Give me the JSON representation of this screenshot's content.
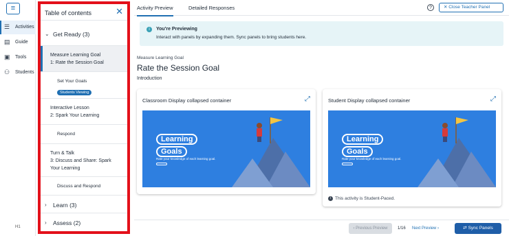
{
  "rail": {
    "menu_icon": "hamburger-icon",
    "items": [
      {
        "label": "Activities",
        "icon": "list-icon"
      },
      {
        "label": "Guide",
        "icon": "book-icon"
      },
      {
        "label": "Tools",
        "icon": "toolbox-icon"
      },
      {
        "label": "Students",
        "icon": "people-icon"
      }
    ],
    "footer_alt": "H1"
  },
  "toc": {
    "title": "Table of contents",
    "sections": [
      {
        "label": "Get Ready (3)",
        "expanded": true
      },
      {
        "label": "Learn (3)",
        "expanded": false
      },
      {
        "label": "Assess (2)",
        "expanded": false
      }
    ],
    "lessons": [
      {
        "line1": "Measure Learning Goal",
        "line2": "1: Rate the Session Goal",
        "sub": "Set Your Goals",
        "badge": "Students Viewing"
      },
      {
        "line1": "Interactive Lesson",
        "line2": "2: Spark Your Learning",
        "sub": "Respond"
      },
      {
        "line1": "Turn & Talk",
        "line2": "3: Discuss and Share: Spark Your Learning",
        "sub": "Discuss and Respond"
      }
    ]
  },
  "tabs": [
    {
      "label": "Activity Preview",
      "active": true
    },
    {
      "label": "Detailed Responses",
      "active": false
    }
  ],
  "header": {
    "help_glyph": "?",
    "close_label": "Close Teacher Panel"
  },
  "notice": {
    "title": "You're Previewing",
    "body": "Interact with panels by expanding them. Sync panels to bring students here."
  },
  "main": {
    "breadcrumb": "Measure Learning Goal",
    "title": "Rate the Session Goal",
    "intro": "Introduction"
  },
  "cards": [
    {
      "title": "Classroom Display collapsed container",
      "slide_line1": "Learning",
      "slide_line2": "Goals",
      "slide_sub": "Rate your knowledge of each learning goal."
    },
    {
      "title": "Student Display collapsed container",
      "slide_line1": "Learning",
      "slide_line2": "Goals",
      "slide_sub": "Rate your knowledge of each learning goal.",
      "note": "This activity is Student-Paced."
    }
  ],
  "footer": {
    "prev_label": "Previous Preview",
    "page": "1/16",
    "next_label": "Next Preview",
    "sync_label": "Sync Panels"
  },
  "colors": {
    "accent": "#1f6fb2",
    "highlight_border": "#e3101a",
    "slide_bg": "#2e7fe0"
  }
}
